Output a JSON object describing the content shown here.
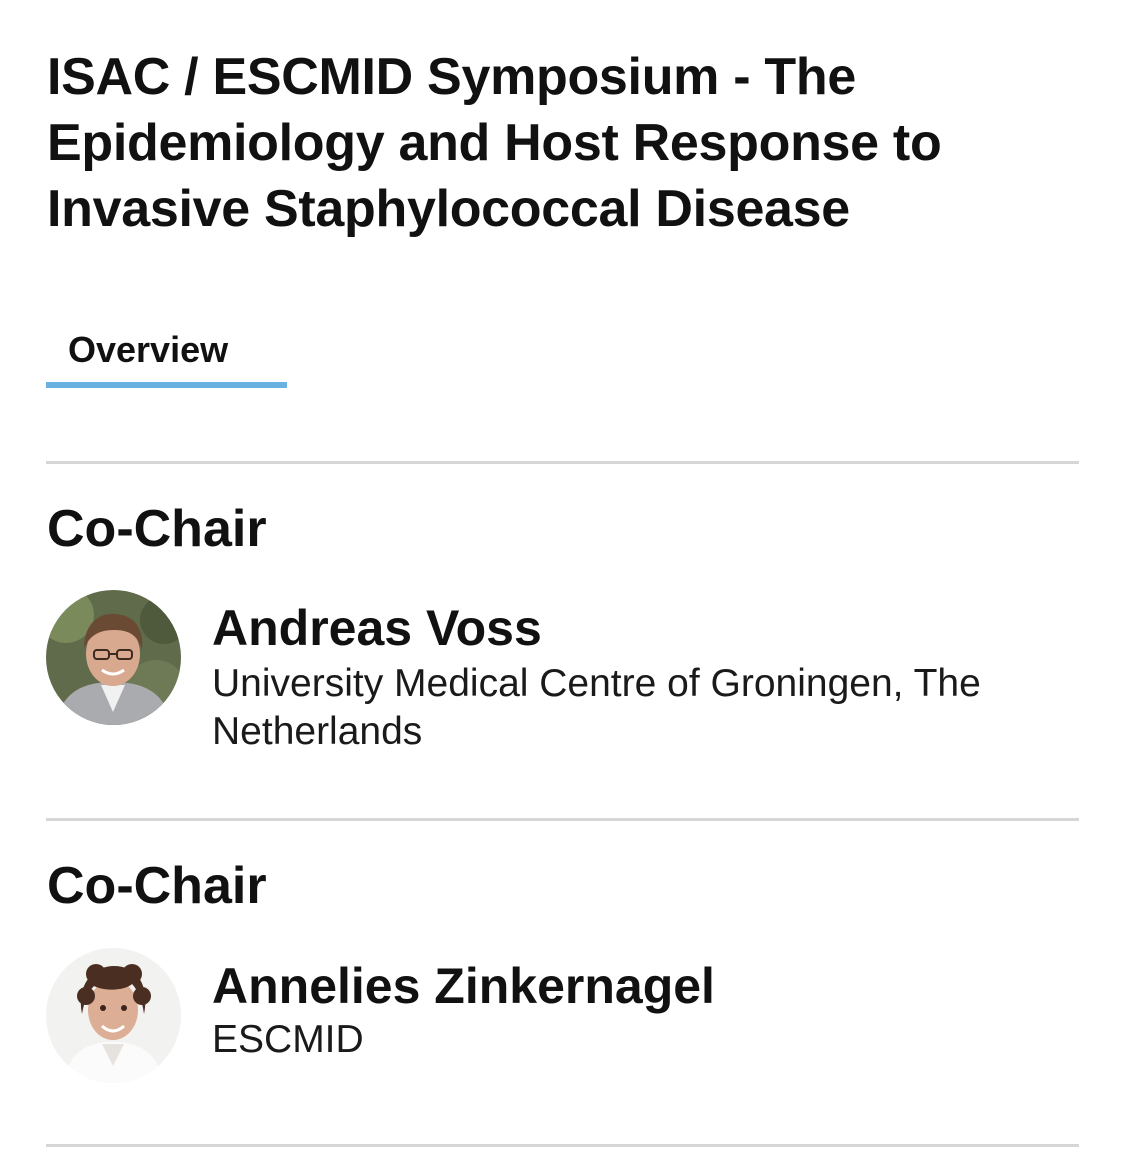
{
  "session": {
    "title": "ISAC / ESCMID Symposium - The Epidemiology and Host Response to Invasive Staphylococcal Disease"
  },
  "tabs": [
    {
      "label": "Overview",
      "selected": true
    }
  ],
  "accent_color": "#6ab1e2",
  "chairs": [
    {
      "role": "Co-Chair",
      "name": "Andreas Voss",
      "affiliation": "University Medical Centre of Groningen, The Netherlands"
    },
    {
      "role": "Co-Chair",
      "name": "Annelies Zinkernagel",
      "affiliation": "ESCMID"
    }
  ]
}
